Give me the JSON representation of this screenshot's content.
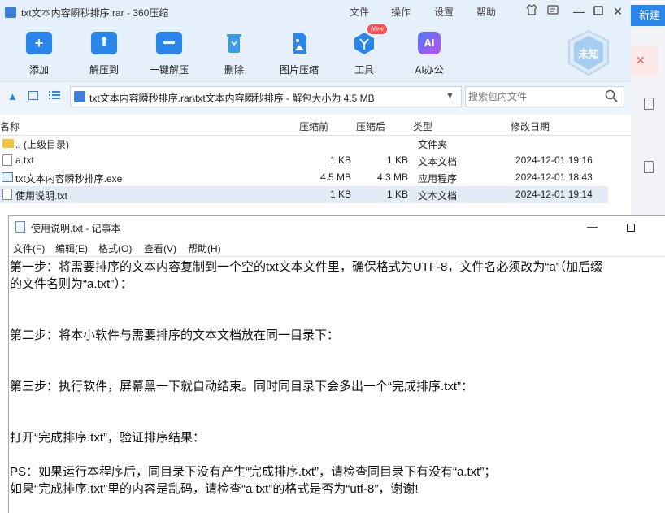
{
  "archiver": {
    "title": "txt文本内容瞬秒排序.rar - 360压缩",
    "menu": [
      "文件",
      "操作",
      "设置",
      "帮助"
    ],
    "toolbar": [
      {
        "label": "添加",
        "icon": "add-icon"
      },
      {
        "label": "解压到",
        "icon": "extract-to-icon"
      },
      {
        "label": "一键解压",
        "icon": "one-click-extract-icon"
      },
      {
        "label": "删除",
        "icon": "trash-icon"
      },
      {
        "label": "图片压缩",
        "icon": "image-compress-icon"
      },
      {
        "label": "工具",
        "icon": "tools-icon",
        "badge": "New"
      },
      {
        "label": "AI办公",
        "icon": "ai-icon",
        "badge_text": "AI"
      }
    ],
    "shield_label": "未知",
    "path": "txt文本内容瞬秒排序.rar\\txt文本内容瞬秒排序 - 解包大小为 4.5 MB",
    "search_placeholder": "搜索包内文件",
    "columns": {
      "name": "名称",
      "compressed": "压缩前",
      "after": "压缩后",
      "type": "类型",
      "modified": "修改日期"
    },
    "files": [
      {
        "name": ".. (上级目录)",
        "before": "",
        "after": "",
        "type": "文件夹",
        "date": "",
        "icon": "folder-icon"
      },
      {
        "name": "a.txt",
        "before": "1 KB",
        "after": "1 KB",
        "type": "文本文档",
        "date": "2024-12-01 19:16",
        "icon": "text-file-icon"
      },
      {
        "name": "txt文本内容瞬秒排序.exe",
        "before": "4.5 MB",
        "after": "4.3 MB",
        "type": "应用程序",
        "date": "2024-12-01 18:43",
        "icon": "exe-file-icon"
      },
      {
        "name": "使用说明.txt",
        "before": "1 KB",
        "after": "1 KB",
        "type": "文本文档",
        "date": "2024-12-01 19:14",
        "icon": "text-file-icon"
      }
    ]
  },
  "background": {
    "new_button": "新建"
  },
  "notepad": {
    "title": "使用说明.txt - 记事本",
    "menu": [
      "文件(F)",
      "编辑(E)",
      "格式(O)",
      "查看(V)",
      "帮助(H)"
    ],
    "lines": [
      "第一步：将需要排序的文本内容复制到一个空的txt文本文件里，确保格式为UTF-8，文件名必须改为“a”（加后缀",
      "的文件名则为“a.txt”）：",
      "",
      "",
      "第二步：将本小软件与需要排序的文本文档放在同一目录下：",
      "",
      "",
      "第三步：执行软件，屏幕黑一下就自动结束。同时同目录下会多出一个“完成排序.txt”：",
      "",
      "",
      "打开“完成排序.txt”，验证排序结果：",
      "",
      "PS：如果运行本程序后，同目录下没有产生“完成排序.txt”，请检查同目录下有没有“a.txt”；",
      "如果“完成排序.txt”里的内容是乱码，请检查“a.txt”的格式是否为“utf-8”，谢谢!"
    ]
  },
  "colors": {
    "accent": "#2a86e8",
    "titlebar": "#e6f0fb",
    "selected_row": "#dde8f6"
  }
}
